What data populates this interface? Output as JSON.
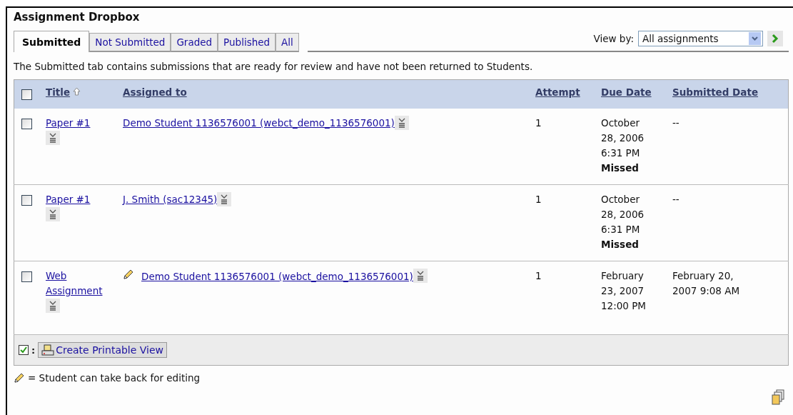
{
  "page": {
    "title": "Assignment Dropbox"
  },
  "tabs": [
    {
      "label": "Submitted",
      "selected": true
    },
    {
      "label": "Not Submitted",
      "selected": false
    },
    {
      "label": "Graded",
      "selected": false
    },
    {
      "label": "Published",
      "selected": false
    },
    {
      "label": "All",
      "selected": false
    }
  ],
  "view_by": {
    "label": "View by:",
    "value": "All assignments"
  },
  "description": "The Submitted tab contains submissions that are ready for review and have not been returned to Students.",
  "table": {
    "select_all_checked": false,
    "columns": [
      {
        "label": "Title",
        "sorted": true
      },
      {
        "label": "Assigned to",
        "sorted": false
      },
      {
        "label": "Attempt",
        "sorted": false
      },
      {
        "label": "Due Date",
        "sorted": false
      },
      {
        "label": "Submitted Date",
        "sorted": false
      }
    ],
    "rows": [
      {
        "selected": false,
        "title": "Paper #1",
        "editable": false,
        "assigned_to": "Demo Student 1136576001 (webct_demo_1136576001)",
        "attempt": "1",
        "due_date": [
          "October",
          "28, 2006",
          "6:31 PM"
        ],
        "due_status": "Missed",
        "submitted_date": [
          "--"
        ]
      },
      {
        "selected": false,
        "title": "Paper #1",
        "editable": false,
        "assigned_to": "J. Smith (sac12345)",
        "attempt": "1",
        "due_date": [
          "October",
          "28, 2006",
          "6:31 PM"
        ],
        "due_status": "Missed",
        "submitted_date": [
          "--"
        ]
      },
      {
        "selected": false,
        "title": "Web Assignment",
        "editable": true,
        "assigned_to": "Demo Student 1136576001 (webct_demo_1136576001)",
        "attempt": "1",
        "due_date": [
          "February",
          "23, 2007",
          "12:00 PM"
        ],
        "submitted_date": [
          "February 20,",
          "2007 9:08 AM"
        ]
      }
    ]
  },
  "footer": {
    "separator": ":",
    "button": "Create Printable View"
  },
  "legend": "= Student can take back for editing"
}
